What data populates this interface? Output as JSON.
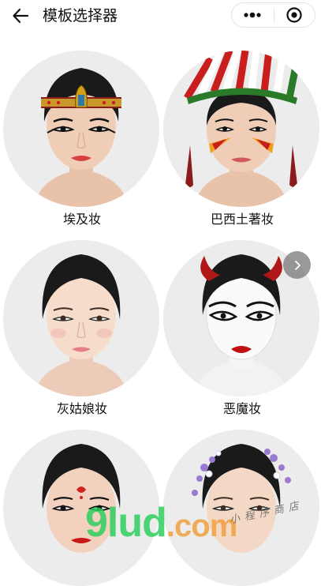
{
  "header": {
    "title": "模板选择器",
    "back_icon": "arrow-left-icon",
    "more_icon": "more-dots-icon",
    "close_icon": "target-circle-icon"
  },
  "templates": [
    {
      "name": "埃及妆",
      "theme": "egyptian",
      "accent": "#d4a017"
    },
    {
      "name": "巴西土著妆",
      "theme": "brazil",
      "accent": "#c81e1e"
    },
    {
      "name": "灰姑娘妆",
      "theme": "cinderella",
      "accent": "#e8a0a0"
    },
    {
      "name": "恶魔妆",
      "theme": "devil",
      "accent": "#b01818"
    },
    {
      "name": "",
      "theme": "indian",
      "accent": "#d02020"
    },
    {
      "name": "",
      "theme": "floral",
      "accent": "#9a7ad0"
    }
  ],
  "next_button_icon": "chevron-right-icon",
  "watermark": {
    "logo": "9lud",
    "suffix": ".com",
    "chinese": "小程序商店"
  },
  "colors": {
    "thumb_bg": "#ececec",
    "hair": "#1a1a1a",
    "skin": "#f2d2bf"
  }
}
